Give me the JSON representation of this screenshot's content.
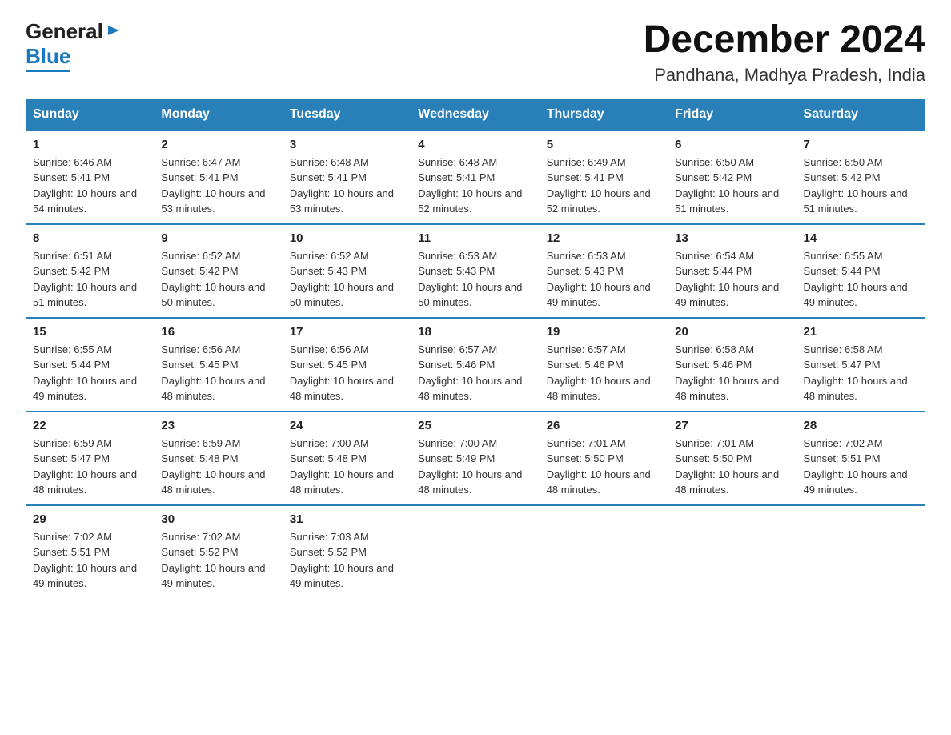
{
  "header": {
    "logo_general": "General",
    "logo_blue": "Blue",
    "month_title": "December 2024",
    "location": "Pandhana, Madhya Pradesh, India"
  },
  "days_of_week": [
    "Sunday",
    "Monday",
    "Tuesday",
    "Wednesday",
    "Thursday",
    "Friday",
    "Saturday"
  ],
  "weeks": [
    [
      {
        "day": "1",
        "sunrise": "Sunrise: 6:46 AM",
        "sunset": "Sunset: 5:41 PM",
        "daylight": "Daylight: 10 hours and 54 minutes."
      },
      {
        "day": "2",
        "sunrise": "Sunrise: 6:47 AM",
        "sunset": "Sunset: 5:41 PM",
        "daylight": "Daylight: 10 hours and 53 minutes."
      },
      {
        "day": "3",
        "sunrise": "Sunrise: 6:48 AM",
        "sunset": "Sunset: 5:41 PM",
        "daylight": "Daylight: 10 hours and 53 minutes."
      },
      {
        "day": "4",
        "sunrise": "Sunrise: 6:48 AM",
        "sunset": "Sunset: 5:41 PM",
        "daylight": "Daylight: 10 hours and 52 minutes."
      },
      {
        "day": "5",
        "sunrise": "Sunrise: 6:49 AM",
        "sunset": "Sunset: 5:41 PM",
        "daylight": "Daylight: 10 hours and 52 minutes."
      },
      {
        "day": "6",
        "sunrise": "Sunrise: 6:50 AM",
        "sunset": "Sunset: 5:42 PM",
        "daylight": "Daylight: 10 hours and 51 minutes."
      },
      {
        "day": "7",
        "sunrise": "Sunrise: 6:50 AM",
        "sunset": "Sunset: 5:42 PM",
        "daylight": "Daylight: 10 hours and 51 minutes."
      }
    ],
    [
      {
        "day": "8",
        "sunrise": "Sunrise: 6:51 AM",
        "sunset": "Sunset: 5:42 PM",
        "daylight": "Daylight: 10 hours and 51 minutes."
      },
      {
        "day": "9",
        "sunrise": "Sunrise: 6:52 AM",
        "sunset": "Sunset: 5:42 PM",
        "daylight": "Daylight: 10 hours and 50 minutes."
      },
      {
        "day": "10",
        "sunrise": "Sunrise: 6:52 AM",
        "sunset": "Sunset: 5:43 PM",
        "daylight": "Daylight: 10 hours and 50 minutes."
      },
      {
        "day": "11",
        "sunrise": "Sunrise: 6:53 AM",
        "sunset": "Sunset: 5:43 PM",
        "daylight": "Daylight: 10 hours and 50 minutes."
      },
      {
        "day": "12",
        "sunrise": "Sunrise: 6:53 AM",
        "sunset": "Sunset: 5:43 PM",
        "daylight": "Daylight: 10 hours and 49 minutes."
      },
      {
        "day": "13",
        "sunrise": "Sunrise: 6:54 AM",
        "sunset": "Sunset: 5:44 PM",
        "daylight": "Daylight: 10 hours and 49 minutes."
      },
      {
        "day": "14",
        "sunrise": "Sunrise: 6:55 AM",
        "sunset": "Sunset: 5:44 PM",
        "daylight": "Daylight: 10 hours and 49 minutes."
      }
    ],
    [
      {
        "day": "15",
        "sunrise": "Sunrise: 6:55 AM",
        "sunset": "Sunset: 5:44 PM",
        "daylight": "Daylight: 10 hours and 49 minutes."
      },
      {
        "day": "16",
        "sunrise": "Sunrise: 6:56 AM",
        "sunset": "Sunset: 5:45 PM",
        "daylight": "Daylight: 10 hours and 48 minutes."
      },
      {
        "day": "17",
        "sunrise": "Sunrise: 6:56 AM",
        "sunset": "Sunset: 5:45 PM",
        "daylight": "Daylight: 10 hours and 48 minutes."
      },
      {
        "day": "18",
        "sunrise": "Sunrise: 6:57 AM",
        "sunset": "Sunset: 5:46 PM",
        "daylight": "Daylight: 10 hours and 48 minutes."
      },
      {
        "day": "19",
        "sunrise": "Sunrise: 6:57 AM",
        "sunset": "Sunset: 5:46 PM",
        "daylight": "Daylight: 10 hours and 48 minutes."
      },
      {
        "day": "20",
        "sunrise": "Sunrise: 6:58 AM",
        "sunset": "Sunset: 5:46 PM",
        "daylight": "Daylight: 10 hours and 48 minutes."
      },
      {
        "day": "21",
        "sunrise": "Sunrise: 6:58 AM",
        "sunset": "Sunset: 5:47 PM",
        "daylight": "Daylight: 10 hours and 48 minutes."
      }
    ],
    [
      {
        "day": "22",
        "sunrise": "Sunrise: 6:59 AM",
        "sunset": "Sunset: 5:47 PM",
        "daylight": "Daylight: 10 hours and 48 minutes."
      },
      {
        "day": "23",
        "sunrise": "Sunrise: 6:59 AM",
        "sunset": "Sunset: 5:48 PM",
        "daylight": "Daylight: 10 hours and 48 minutes."
      },
      {
        "day": "24",
        "sunrise": "Sunrise: 7:00 AM",
        "sunset": "Sunset: 5:48 PM",
        "daylight": "Daylight: 10 hours and 48 minutes."
      },
      {
        "day": "25",
        "sunrise": "Sunrise: 7:00 AM",
        "sunset": "Sunset: 5:49 PM",
        "daylight": "Daylight: 10 hours and 48 minutes."
      },
      {
        "day": "26",
        "sunrise": "Sunrise: 7:01 AM",
        "sunset": "Sunset: 5:50 PM",
        "daylight": "Daylight: 10 hours and 48 minutes."
      },
      {
        "day": "27",
        "sunrise": "Sunrise: 7:01 AM",
        "sunset": "Sunset: 5:50 PM",
        "daylight": "Daylight: 10 hours and 48 minutes."
      },
      {
        "day": "28",
        "sunrise": "Sunrise: 7:02 AM",
        "sunset": "Sunset: 5:51 PM",
        "daylight": "Daylight: 10 hours and 49 minutes."
      }
    ],
    [
      {
        "day": "29",
        "sunrise": "Sunrise: 7:02 AM",
        "sunset": "Sunset: 5:51 PM",
        "daylight": "Daylight: 10 hours and 49 minutes."
      },
      {
        "day": "30",
        "sunrise": "Sunrise: 7:02 AM",
        "sunset": "Sunset: 5:52 PM",
        "daylight": "Daylight: 10 hours and 49 minutes."
      },
      {
        "day": "31",
        "sunrise": "Sunrise: 7:03 AM",
        "sunset": "Sunset: 5:52 PM",
        "daylight": "Daylight: 10 hours and 49 minutes."
      },
      null,
      null,
      null,
      null
    ]
  ]
}
